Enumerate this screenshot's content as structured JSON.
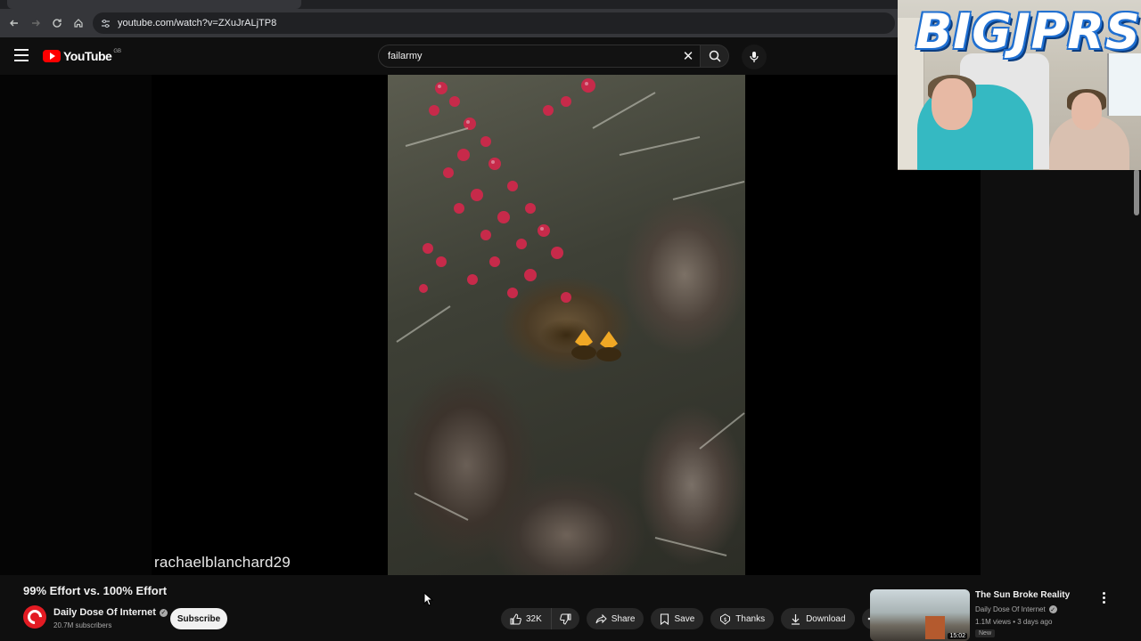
{
  "browser": {
    "url": "youtube.com/watch?v=ZXuJrALjTP8",
    "back_icon": "arrow-left-icon",
    "forward_icon": "arrow-right-icon",
    "reload_icon": "reload-icon",
    "home_icon": "home-icon"
  },
  "masthead": {
    "logo_text": "YouTube",
    "region": "GB",
    "search_value": "failarmy"
  },
  "video": {
    "watermark": "rachaelblanchard29",
    "title": "99% Effort vs. 100% Effort",
    "channel": "Daily Dose Of Internet",
    "subscribers": "20.7M subscribers",
    "subscribe_label": "Subscribe"
  },
  "actions": {
    "like_count": "32K",
    "share": "Share",
    "save": "Save",
    "thanks": "Thanks",
    "download": "Download"
  },
  "recommendation": {
    "title": "The Sun Broke Reality",
    "channel": "Daily Dose Of Internet",
    "meta": "1.1M views • 3 days ago",
    "badge": "New",
    "duration": "15:02"
  },
  "webcam": {
    "overlay_text": "BIGJPRS"
  },
  "colors": {
    "background": "#0f0f0f",
    "brand_red": "#ff0000",
    "pill": "#272727"
  }
}
